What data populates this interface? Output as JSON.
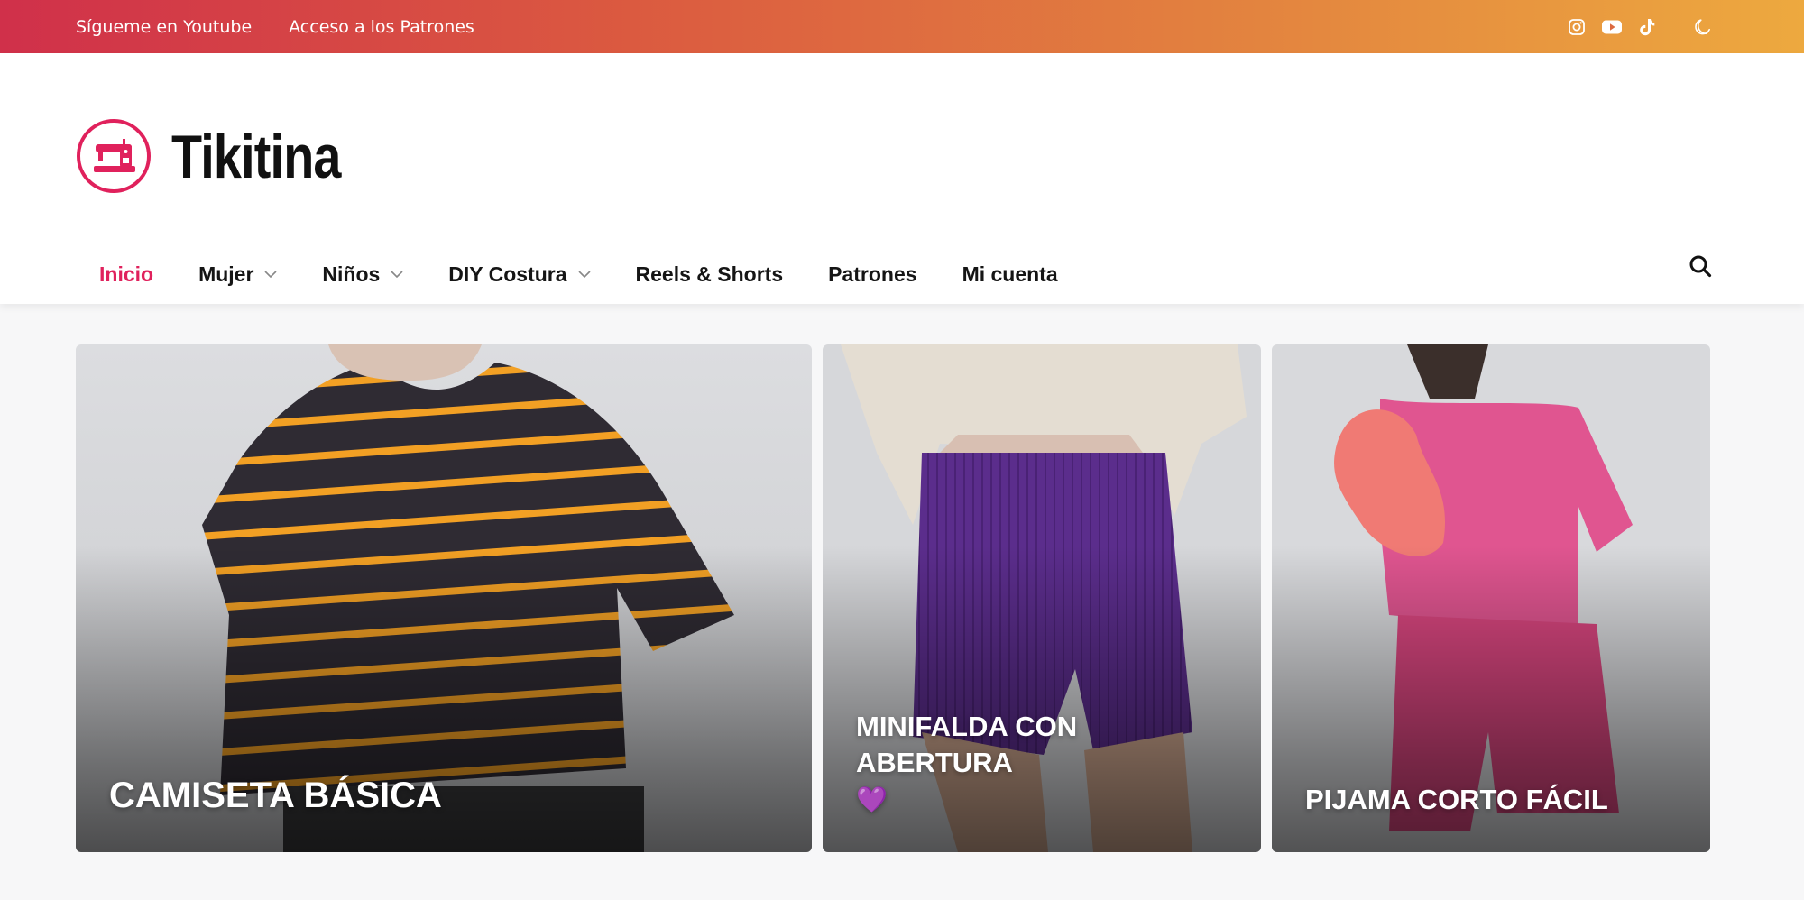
{
  "topbar": {
    "links": [
      "Sígueme en Youtube",
      "Acceso a los Patrones"
    ],
    "social": [
      "instagram-icon",
      "youtube-icon",
      "tiktok-icon"
    ],
    "theme_toggle": "moon-icon",
    "gradient": [
      "#d0304a",
      "#eda93f"
    ]
  },
  "site": {
    "name": "Tikitina",
    "accent": "#e0215c",
    "logo_icon": "sewing-machine-icon"
  },
  "nav": {
    "items": [
      {
        "label": "Inicio",
        "active": true
      },
      {
        "label": "Mujer",
        "dropdown": true
      },
      {
        "label": "Niños",
        "dropdown": true
      },
      {
        "label": "DIY Costura",
        "dropdown": true
      },
      {
        "label": "Reels & Shorts"
      },
      {
        "label": "Patrones"
      },
      {
        "label": "Mi cuenta"
      }
    ],
    "search_icon": "search-icon"
  },
  "featured": [
    {
      "title": "CAMISETA BÁSICA"
    },
    {
      "title": "MINIFALDA CON ABERTURA",
      "emoji": "💜"
    },
    {
      "title": "PIJAMA CORTO FÁCIL"
    }
  ]
}
